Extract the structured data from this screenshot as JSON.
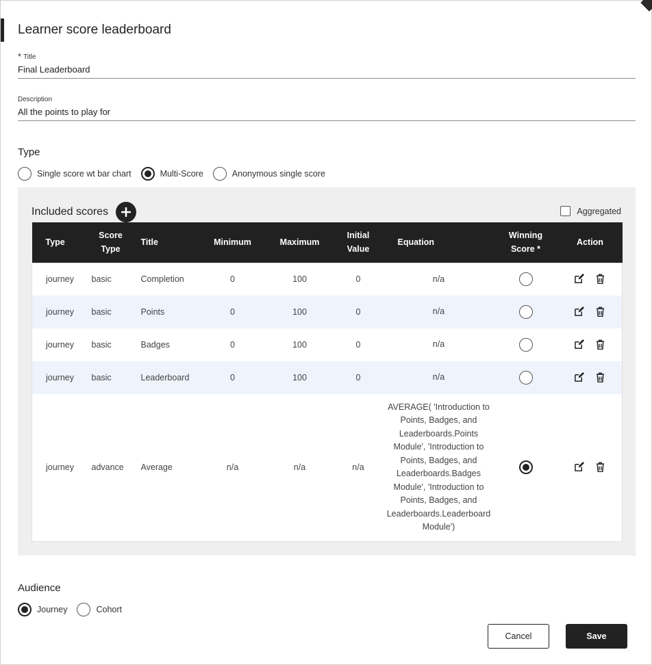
{
  "dialog": {
    "title": "Learner score leaderboard"
  },
  "form": {
    "title_label": "Title",
    "title_required_mark": "*",
    "title_value": "Final Leaderboard",
    "description_label": "Description",
    "description_value": "All the points to play for"
  },
  "type": {
    "label": "Type",
    "options": [
      {
        "label": "Single score wt bar chart",
        "checked": false
      },
      {
        "label": "Multi-Score",
        "checked": true
      },
      {
        "label": "Anonymous single score",
        "checked": false
      }
    ]
  },
  "scores": {
    "title": "Included scores",
    "aggregated_label": "Aggregated",
    "columns": {
      "type": "Type",
      "score_type_1": "Score",
      "score_type_2": "Type",
      "title": "Title",
      "minimum": "Minimum",
      "maximum": "Maximum",
      "initial_1": "Initial",
      "initial_2": "Value",
      "equation": "Equation",
      "winning_1": "Winning",
      "winning_2": "Score *",
      "action": "Action"
    },
    "rows": [
      {
        "type": "journey",
        "score_type": "basic",
        "title": "Completion",
        "minimum": "0",
        "maximum": "100",
        "initial": "0",
        "equation": "n/a",
        "winning": false
      },
      {
        "type": "journey",
        "score_type": "basic",
        "title": "Points",
        "minimum": "0",
        "maximum": "100",
        "initial": "0",
        "equation": "n/a",
        "winning": false
      },
      {
        "type": "journey",
        "score_type": "basic",
        "title": "Badges",
        "minimum": "0",
        "maximum": "100",
        "initial": "0",
        "equation": "n/a",
        "winning": false
      },
      {
        "type": "journey",
        "score_type": "basic",
        "title": "Leaderboard",
        "minimum": "0",
        "maximum": "100",
        "initial": "0",
        "equation": "n/a",
        "winning": false
      },
      {
        "type": "journey",
        "score_type": "advance",
        "title": "Average",
        "minimum": "n/a",
        "maximum": "n/a",
        "initial": "n/a",
        "equation": "AVERAGE( 'Introduction to Points, Badges, and Leaderboards.Points Module',  'Introduction to Points, Badges, and Leaderboards.Badges Module', 'Introduction to Points, Badges, and Leaderboards.Leaderboard Module')",
        "winning": true
      }
    ]
  },
  "audience": {
    "label": "Audience",
    "options": [
      {
        "label": "Journey",
        "checked": true
      },
      {
        "label": "Cohort",
        "checked": false
      }
    ]
  },
  "buttons": {
    "cancel": "Cancel",
    "save": "Save"
  },
  "icons": {
    "add": "plus-icon",
    "edit": "edit-icon",
    "delete": "trash-icon"
  }
}
